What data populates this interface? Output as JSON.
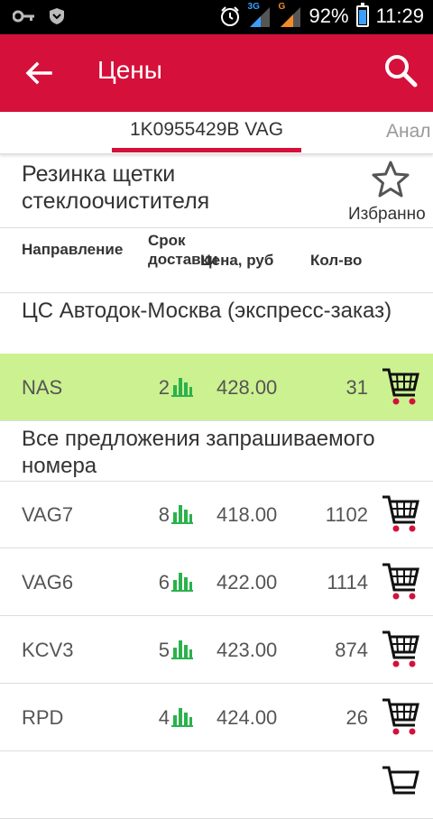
{
  "status_bar": {
    "network_1": "3G",
    "network_2": "G",
    "battery": "92%",
    "time": "11:29"
  },
  "app_bar": {
    "title": "Цены",
    "back_icon": "arrow-back-icon",
    "search_icon": "search-icon"
  },
  "tabs": [
    {
      "label": "1K0955429B VAG",
      "active": true
    },
    {
      "label": "Анал",
      "active": false
    }
  ],
  "product": {
    "name": "Резинка щетки стеклоочистителя",
    "favorite_label": "Избранно",
    "favorite_icon": "star-outline-icon"
  },
  "columns": {
    "direction": "Направление",
    "delivery_term": "Срок доставки",
    "price": "Цена, руб",
    "quantity": "Кол-во"
  },
  "sections": [
    {
      "title": "ЦС Автодок-Москва (экспресс-заказ)",
      "rows": [
        {
          "direction": "NAS",
          "term": "2",
          "price": "428.00",
          "quantity": "31",
          "highlighted": true
        }
      ]
    },
    {
      "title": "Все предложения запрашиваемого номера",
      "rows": [
        {
          "direction": "VAG7",
          "term": "8",
          "price": "418.00",
          "quantity": "1102"
        },
        {
          "direction": "VAG6",
          "term": "6",
          "price": "422.00",
          "quantity": "1114"
        },
        {
          "direction": "KCV3",
          "term": "5",
          "price": "423.00",
          "quantity": "874"
        },
        {
          "direction": "RPD",
          "term": "4",
          "price": "424.00",
          "quantity": "26"
        }
      ]
    }
  ],
  "colors": {
    "accent": "#d5103a",
    "highlight_row": "#ccf190",
    "stats_icon": "#2bb24c",
    "cart_wheel": "#d5103a"
  }
}
